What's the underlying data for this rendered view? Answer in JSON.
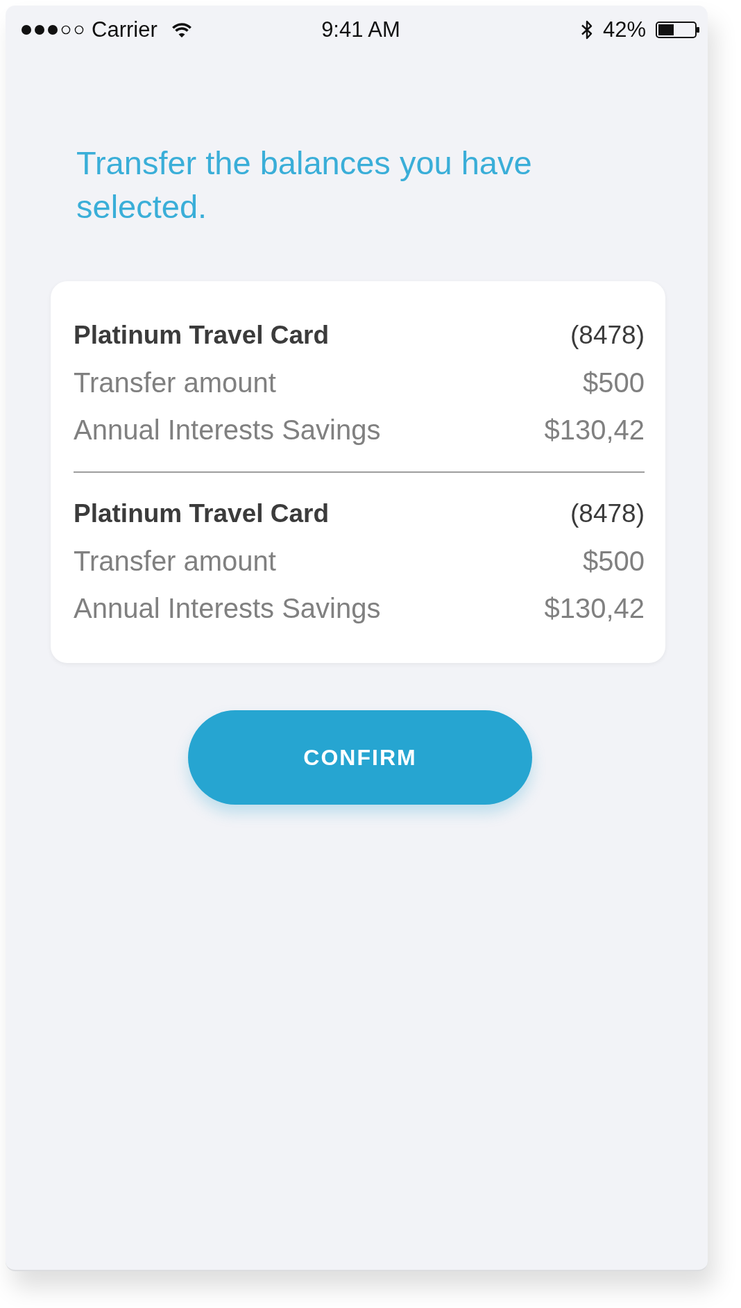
{
  "status_bar": {
    "carrier": "Carrier",
    "time": "9:41 AM",
    "battery": "42%"
  },
  "title": "Transfer the balances you have selected.",
  "transfers": [
    {
      "card_name": "Platinum Travel Card",
      "card_number": "(8478)",
      "rows": [
        {
          "label": "Transfer amount",
          "value": "$500"
        },
        {
          "label": "Annual Interests Savings",
          "value": "$130,42"
        }
      ]
    },
    {
      "card_name": "Platinum Travel Card",
      "card_number": "(8478)",
      "rows": [
        {
          "label": "Transfer amount",
          "value": "$500"
        },
        {
          "label": "Annual Interests Savings",
          "value": "$130,42"
        }
      ]
    }
  ],
  "button": {
    "label": "CONFIRM"
  }
}
